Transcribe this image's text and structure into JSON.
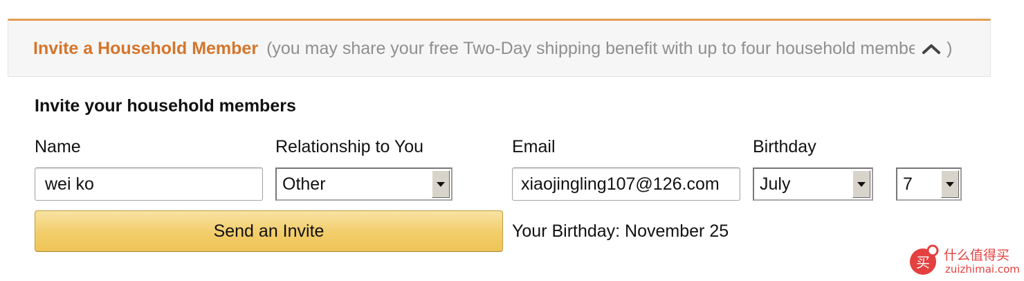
{
  "header": {
    "title": "Invite a Household Member",
    "description": "(you may share your free Two-Day shipping benefit with up to four household members",
    "close_paren": ")",
    "collapse_icon": "chevron-up-icon",
    "accent_color": "#d5752a",
    "border_color": "#e59b4f"
  },
  "section": {
    "heading": "Invite your household members"
  },
  "form": {
    "name_label": "Name",
    "name_value": "wei ko",
    "relationship_label": "Relationship to You",
    "relationship_value": "Other",
    "email_label": "Email",
    "email_value": "xiaojingling107@126.com",
    "birthday_label": "Birthday",
    "birthday_month": "July",
    "birthday_day": "7",
    "send_button": "Send an Invite",
    "birthday_note": "Your Birthday: November 25"
  },
  "watermark": {
    "logo_char": "买",
    "text_cn": "什么值得买",
    "text_en": "zuizhimai.com",
    "color": "#e44040"
  }
}
